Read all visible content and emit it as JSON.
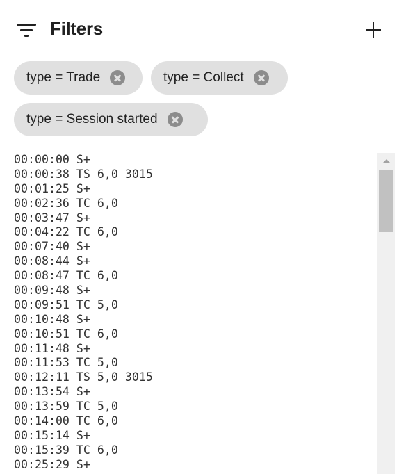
{
  "header": {
    "icon": "filter-list-icon",
    "title": "Filters",
    "add_icon": "plus-icon"
  },
  "filters": [
    {
      "label": "type = Trade",
      "remove_icon": "cancel-icon"
    },
    {
      "label": "type = Collect",
      "remove_icon": "cancel-icon"
    },
    {
      "label": "type = Session started",
      "remove_icon": "cancel-icon"
    }
  ],
  "log": {
    "lines": [
      "00:00:00 S+",
      "00:00:38 TS 6,0 3015",
      "00:01:25 S+",
      "00:02:36 TC 6,0",
      "00:03:47 S+",
      "00:04:22 TC 6,0",
      "00:07:40 S+",
      "00:08:44 S+",
      "00:08:47 TC 6,0",
      "00:09:48 S+",
      "00:09:51 TC 5,0",
      "00:10:48 S+",
      "00:10:51 TC 6,0",
      "00:11:48 S+",
      "00:11:53 TC 5,0",
      "00:12:11 TS 5,0 3015",
      "00:13:54 S+",
      "00:13:59 TC 5,0",
      "00:14:00 TC 6,0",
      "00:15:14 S+",
      "00:15:39 TC 6,0",
      "00:25:29 S+"
    ]
  },
  "scrollbar": {
    "up_icon": "arrow-up-icon",
    "scroll_position": 0
  }
}
